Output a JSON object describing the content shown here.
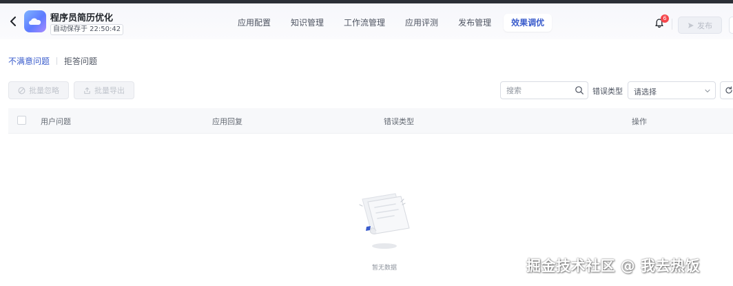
{
  "header": {
    "app_name": "程序员简历优化",
    "autosave": "自动保存于 22:50:42",
    "nav_tabs": [
      {
        "label": "应用配置"
      },
      {
        "label": "知识管理"
      },
      {
        "label": "工作流管理"
      },
      {
        "label": "应用评测"
      },
      {
        "label": "发布管理"
      },
      {
        "label": "效果调优",
        "active": true
      }
    ],
    "notification_count": "6",
    "publish_label": "发布"
  },
  "subtabs": [
    {
      "label": "不满意问题",
      "active": true
    },
    {
      "label": "拒答问题"
    }
  ],
  "toolbar": {
    "bulk_ignore_label": "批量忽略",
    "bulk_export_label": "批量导出",
    "search_placeholder": "搜索",
    "error_type_label": "错误类型",
    "error_type_select": "请选择"
  },
  "table": {
    "columns": [
      "用户问题",
      "应用回复",
      "错误类型",
      "操作"
    ],
    "rows": [],
    "empty_text": "暂无数据"
  },
  "watermark": "掘金技术社区 @ 我去热饭",
  "colors": {
    "accent": "#3a5ccc",
    "badge": "#f5474c",
    "header_bg": "#f6f7fb",
    "table_header_bg": "#f7f8fa"
  }
}
